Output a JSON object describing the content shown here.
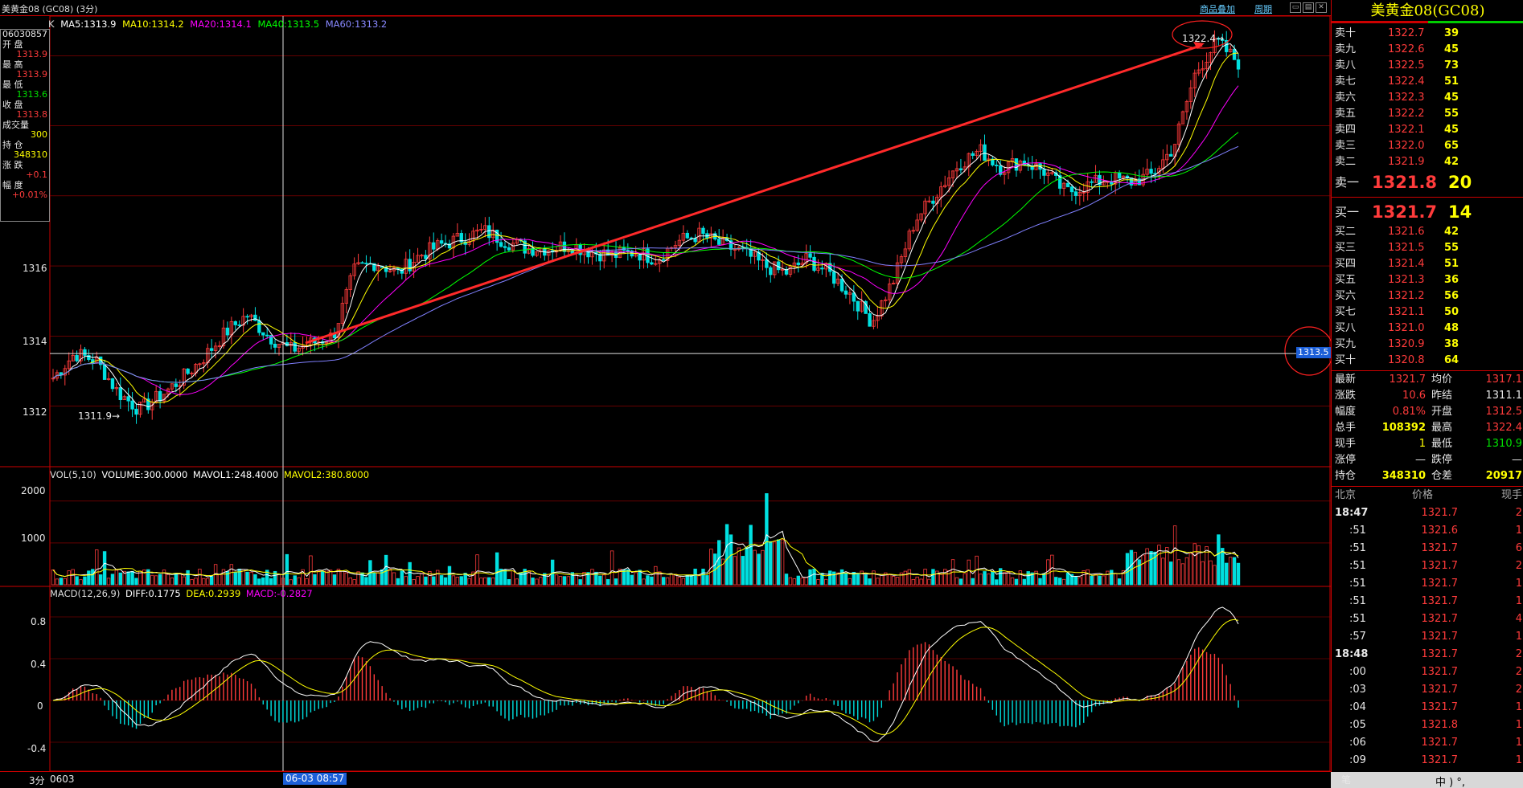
{
  "title": "美黄金08 (GC08) (3分)",
  "links": {
    "overlay": "商品叠加",
    "cycle": "周期"
  },
  "main_legend": {
    "prefix": "K",
    "ma5": "MA5:1313.9",
    "ma10": "MA10:1314.2",
    "ma20": "MA20:1314.1",
    "ma40": "MA40:1313.5",
    "ma60": "MA60:1313.2"
  },
  "infobox": {
    "date": "06030857",
    "open_label": "开 盘",
    "open": "1313.9",
    "high_label": "最 高",
    "high": "1313.9",
    "low_label": "最 低",
    "low": "1313.6",
    "close_label": "收 盘",
    "close": "1313.8",
    "vol_label": "成交量",
    "vol": "300",
    "oi_label": "持 仓",
    "oi": "348310",
    "chg_label": "涨 跌",
    "chg": "+0.1",
    "pct_label": "幅 度",
    "pct": "+0.01%"
  },
  "price_axis": [
    "1316",
    "1314",
    "1312"
  ],
  "annotations": {
    "high": "1322.4→",
    "low": "1311.9→",
    "cursor_price": "1313.5"
  },
  "vol_legend": {
    "prefix": "VOL(5,10)",
    "volume": "VOLUME:300.0000",
    "mavol1": "MAVOL1:248.4000",
    "mavol2": "MAVOL2:380.8000"
  },
  "vol_axis": [
    "2000",
    "1000"
  ],
  "macd_legend": {
    "prefix": "MACD(12,26,9)",
    "diff": "DIFF:0.1775",
    "dea": "DEA:0.2939",
    "macd": "MACD:-0.2827"
  },
  "macd_axis": [
    "0.8",
    "0.4",
    "0",
    "-0.4"
  ],
  "bottom": {
    "period": "3分",
    "date": "0603",
    "cursor_time": "06-03 08:57"
  },
  "panel": {
    "title": "美黄金08(GC08)",
    "asks": [
      {
        "label": "卖十",
        "price": "1322.7",
        "qty": "39"
      },
      {
        "label": "卖九",
        "price": "1322.6",
        "qty": "45"
      },
      {
        "label": "卖八",
        "price": "1322.5",
        "qty": "73"
      },
      {
        "label": "卖七",
        "price": "1322.4",
        "qty": "51"
      },
      {
        "label": "卖六",
        "price": "1322.3",
        "qty": "45"
      },
      {
        "label": "卖五",
        "price": "1322.2",
        "qty": "55"
      },
      {
        "label": "卖四",
        "price": "1322.1",
        "qty": "45"
      },
      {
        "label": "卖三",
        "price": "1322.0",
        "qty": "65"
      },
      {
        "label": "卖二",
        "price": "1321.9",
        "qty": "42"
      },
      {
        "label": "卖一",
        "price": "1321.8",
        "qty": "20"
      }
    ],
    "bids": [
      {
        "label": "买一",
        "price": "1321.7",
        "qty": "14"
      },
      {
        "label": "买二",
        "price": "1321.6",
        "qty": "42"
      },
      {
        "label": "买三",
        "price": "1321.5",
        "qty": "55"
      },
      {
        "label": "买四",
        "price": "1321.4",
        "qty": "51"
      },
      {
        "label": "买五",
        "price": "1321.3",
        "qty": "36"
      },
      {
        "label": "买六",
        "price": "1321.2",
        "qty": "56"
      },
      {
        "label": "买七",
        "price": "1321.1",
        "qty": "50"
      },
      {
        "label": "买八",
        "price": "1321.0",
        "qty": "48"
      },
      {
        "label": "买九",
        "price": "1320.9",
        "qty": "38"
      },
      {
        "label": "买十",
        "price": "1320.8",
        "qty": "64"
      }
    ],
    "stats": [
      {
        "l1": "最新",
        "v1": "1321.7",
        "l2": "均价",
        "v2": "1317.1"
      },
      {
        "l1": "涨跌",
        "v1": "10.6",
        "l2": "昨结",
        "v2": "1311.1"
      },
      {
        "l1": "幅度",
        "v1": "0.81%",
        "l2": "开盘",
        "v2": "1312.5"
      },
      {
        "l1": "总手",
        "v1": "108392",
        "l2": "最高",
        "v2": "1322.4"
      },
      {
        "l1": "现手",
        "v1": "1",
        "l2": "最低",
        "v2": "1310.9"
      },
      {
        "l1": "涨停",
        "v1": "—",
        "l2": "跌停",
        "v2": "—"
      },
      {
        "l1": "持仓",
        "v1": "348310",
        "l2": "仓差",
        "v2": "20917"
      }
    ],
    "ticks_header": {
      "time": "北京",
      "price": "价格",
      "qty": "现手"
    },
    "ticks": [
      {
        "time": "18:47",
        "price": "1321.7",
        "qty": "2"
      },
      {
        "time": ":51",
        "price": "1321.6",
        "qty": "1"
      },
      {
        "time": ":51",
        "price": "1321.7",
        "qty": "6"
      },
      {
        "time": ":51",
        "price": "1321.7",
        "qty": "2"
      },
      {
        "time": ":51",
        "price": "1321.7",
        "qty": "1"
      },
      {
        "time": ":51",
        "price": "1321.7",
        "qty": "1"
      },
      {
        "time": ":51",
        "price": "1321.7",
        "qty": "4"
      },
      {
        "time": ":57",
        "price": "1321.7",
        "qty": "1"
      },
      {
        "time": "18:48",
        "price": "1321.7",
        "qty": "2"
      },
      {
        "time": ":00",
        "price": "1321.7",
        "qty": "2"
      },
      {
        "time": ":03",
        "price": "1321.7",
        "qty": "2"
      },
      {
        "time": ":04",
        "price": "1321.7",
        "qty": "1"
      },
      {
        "time": ":05",
        "price": "1321.8",
        "qty": "1"
      },
      {
        "time": ":06",
        "price": "1321.7",
        "qty": "1"
      },
      {
        "time": ":09",
        "price": "1321.7",
        "qty": "1"
      }
    ],
    "bottom_tab": "笔",
    "taskbar_text": "中 ) °, "
  },
  "colors": {
    "up": "#ff3b3b",
    "down": "#00e0e0",
    "ma5": "#ffffff",
    "ma10": "#ffff00",
    "ma20": "#ff00ff",
    "ma40": "#00ff00",
    "ma60": "#8080ff",
    "grid": "#a00000"
  },
  "chart_data": {
    "type": "candlestick",
    "description_series": [
      {
        "name": "K",
        "shape": [
          1312.8,
          1313.5,
          1313.3,
          1312.4,
          1311.9,
          1312.3,
          1312.8,
          1313.4,
          1314.1,
          1314.6,
          1314.0,
          1313.6,
          1313.8,
          1314.0,
          1315.9,
          1316.1,
          1315.8,
          1316.3,
          1316.6,
          1316.8,
          1317.0,
          1316.7,
          1316.5,
          1316.5,
          1316.6,
          1316.4,
          1316.3,
          1316.4,
          1316.2,
          1316.7,
          1316.9,
          1316.6,
          1316.4,
          1316.0,
          1315.8,
          1316.2,
          1315.8,
          1315.2,
          1314.4,
          1315.6,
          1317.3,
          1318.1,
          1318.9,
          1319.3,
          1318.8,
          1319.0,
          1318.7,
          1318.1,
          1318.3,
          1318.5,
          1318.4,
          1318.6,
          1319.4,
          1321.5,
          1322.4,
          1321.8
        ]
      }
    ],
    "price_ylim": [
      1310.5,
      1322.9
    ],
    "volume_ylim": [
      0,
      2400
    ],
    "macd_ylim": [
      -0.6,
      1.0
    ]
  }
}
